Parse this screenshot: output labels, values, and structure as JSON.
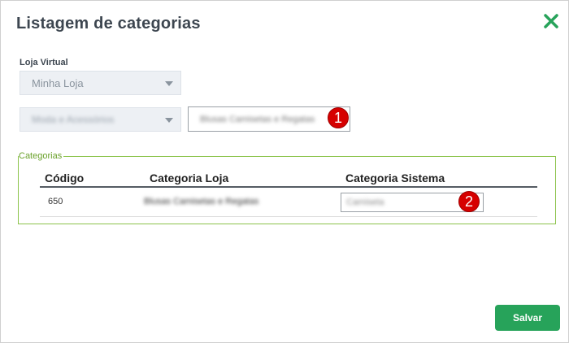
{
  "dialog": {
    "title": "Listagem de categorias",
    "close_icon": "close-x-icon"
  },
  "store_field": {
    "label": "Loja Virtual",
    "selected": "Minha Loja"
  },
  "category_filter": {
    "selected": "Moda e Acessórios",
    "input_value": "Blusas Camisetas e Regatas"
  },
  "markers": [
    "1",
    "2"
  ],
  "categorias": {
    "legend": "Categorias",
    "columns": [
      "Código",
      "Categoria Loja",
      "Categoria Sistema"
    ],
    "rows": [
      {
        "code": "650",
        "store_category": "Blusas Camisetas e Regatas",
        "system_category": "Camiseta"
      }
    ]
  },
  "actions": {
    "save_label": "Salvar"
  },
  "colors": {
    "accent_green": "#27a35a",
    "fieldset_green": "#8bc34a",
    "marker_red": "#d60000"
  }
}
